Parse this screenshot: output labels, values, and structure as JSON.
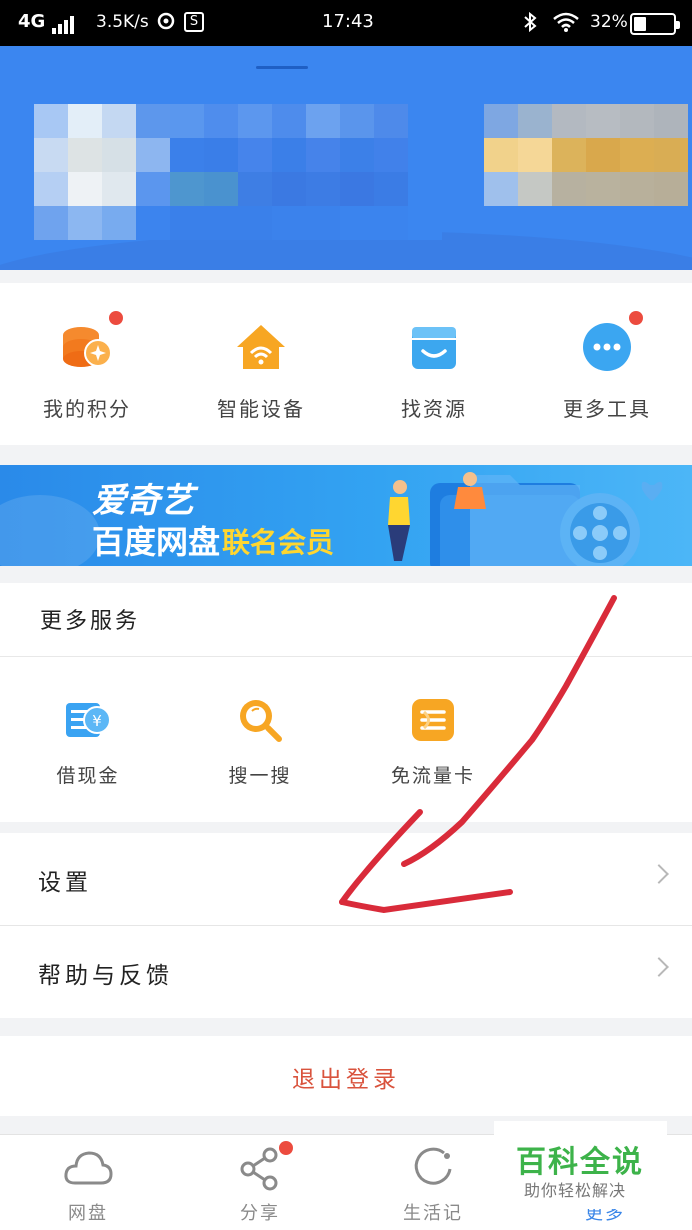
{
  "status_bar": {
    "network": "4G",
    "speed": "3.5K/s",
    "s_badge": "S",
    "time": "17:43",
    "battery": "32%",
    "battery_level": 0.32
  },
  "tools": [
    {
      "label": "我的积分",
      "icon": "coins-icon",
      "badge": true
    },
    {
      "label": "智能设备",
      "icon": "smart-home-icon",
      "badge": false
    },
    {
      "label": "找资源",
      "icon": "store-icon",
      "badge": false
    },
    {
      "label": "更多工具",
      "icon": "more-icon",
      "badge": true
    }
  ],
  "banner": {
    "line1": "爱奇艺",
    "line2": "百度网盘",
    "tagline": "联名会员"
  },
  "services": {
    "title": "更多服务",
    "items": [
      {
        "label": "借现金",
        "icon": "cash-icon"
      },
      {
        "label": "搜一搜",
        "icon": "search-icon"
      },
      {
        "label": "免流量卡",
        "icon": "data-card-icon"
      }
    ]
  },
  "rows": {
    "settings": "设置",
    "help": "帮助与反馈"
  },
  "logout": "退出登录",
  "tabbar": [
    {
      "label": "网盘",
      "icon": "cloud-icon"
    },
    {
      "label": "分享",
      "icon": "share-icon",
      "badge": true
    },
    {
      "label": "生活记",
      "icon": "life-icon"
    },
    {
      "label": "更多",
      "icon": "more-tab-icon"
    }
  ],
  "watermark": {
    "title": "百科全说",
    "subtitle": "助你轻松解决"
  },
  "colors": {
    "header_blue": "#3b86f0",
    "accent_orange": "#f5a623",
    "accent_blue": "#3aa3f2",
    "badge_red": "#ec4b3e",
    "logout_red": "#d9533d",
    "annotation_red": "#d92b3a"
  }
}
